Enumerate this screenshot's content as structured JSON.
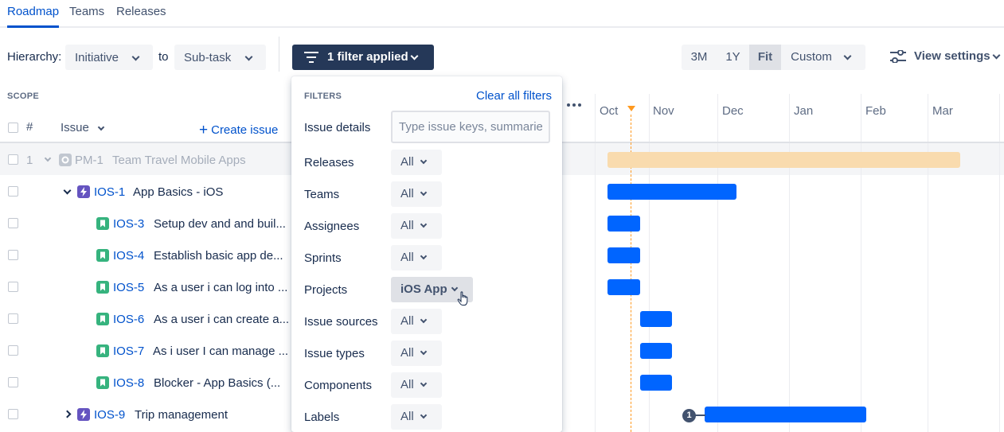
{
  "tabs": [
    {
      "label": "Roadmap",
      "active": true
    },
    {
      "label": "Teams",
      "active": false
    },
    {
      "label": "Releases",
      "active": false
    }
  ],
  "toolbar": {
    "hierarchy_label": "Hierarchy:",
    "hierarchy_from": "Initiative",
    "to_label": "to",
    "hierarchy_to": "Sub-task",
    "filter_button": "1 filter applied",
    "timescale": [
      {
        "label": "3M",
        "active": false
      },
      {
        "label": "1Y",
        "active": false
      },
      {
        "label": "Fit",
        "active": true
      },
      {
        "label": "Custom",
        "active": false
      }
    ],
    "view_settings": "View settings"
  },
  "scope": {
    "title": "SCOPE",
    "col_number": "#",
    "col_issue": "Issue",
    "create_issue": "Create issue"
  },
  "rows": [
    {
      "num": "1",
      "key": "PM-1",
      "title": "Team Travel Mobile Apps",
      "type": "initiative",
      "dimmed": true
    },
    {
      "key": "IOS-1",
      "title": "App Basics - iOS",
      "type": "epic",
      "expanded": true
    },
    {
      "key": "IOS-3",
      "title": "Setup dev and and buil...",
      "type": "story"
    },
    {
      "key": "IOS-4",
      "title": "Establish basic app de...",
      "type": "story"
    },
    {
      "key": "IOS-5",
      "title": "As a user i can log into ...",
      "type": "story"
    },
    {
      "key": "IOS-6",
      "title": "As a user i can create a...",
      "type": "story"
    },
    {
      "key": "IOS-7",
      "title": "As i user I can manage ...",
      "type": "story"
    },
    {
      "key": "IOS-8",
      "title": "Blocker - App Basics (...",
      "type": "story"
    },
    {
      "key": "IOS-9",
      "title": "Trip management",
      "type": "epic",
      "expanded": false
    }
  ],
  "timeline": {
    "months": [
      "Oct",
      "Nov",
      "Dec",
      "Jan",
      "Feb",
      "Mar"
    ],
    "dependency_badge": "1"
  },
  "filters": {
    "title": "FILTERS",
    "clear_all": "Clear all filters",
    "issue_details_label": "Issue details",
    "issue_details_placeholder": "Type issue keys, summaries",
    "items": [
      {
        "label": "Releases",
        "value": "All"
      },
      {
        "label": "Teams",
        "value": "All"
      },
      {
        "label": "Assignees",
        "value": "All"
      },
      {
        "label": "Sprints",
        "value": "All"
      },
      {
        "label": "Projects",
        "value": "iOS App"
      },
      {
        "label": "Issue sources",
        "value": "All"
      },
      {
        "label": "Issue types",
        "value": "All"
      },
      {
        "label": "Components",
        "value": "All"
      },
      {
        "label": "Labels",
        "value": "All"
      }
    ]
  },
  "colors": {
    "accent": "#0052cc",
    "bar": "#0065ff",
    "initiative_bar": "#f9dbae",
    "epic_icon": "#6554c0",
    "story_icon": "#36b37e",
    "today_marker": "#ff991f",
    "filter_button_bg": "#253858"
  }
}
